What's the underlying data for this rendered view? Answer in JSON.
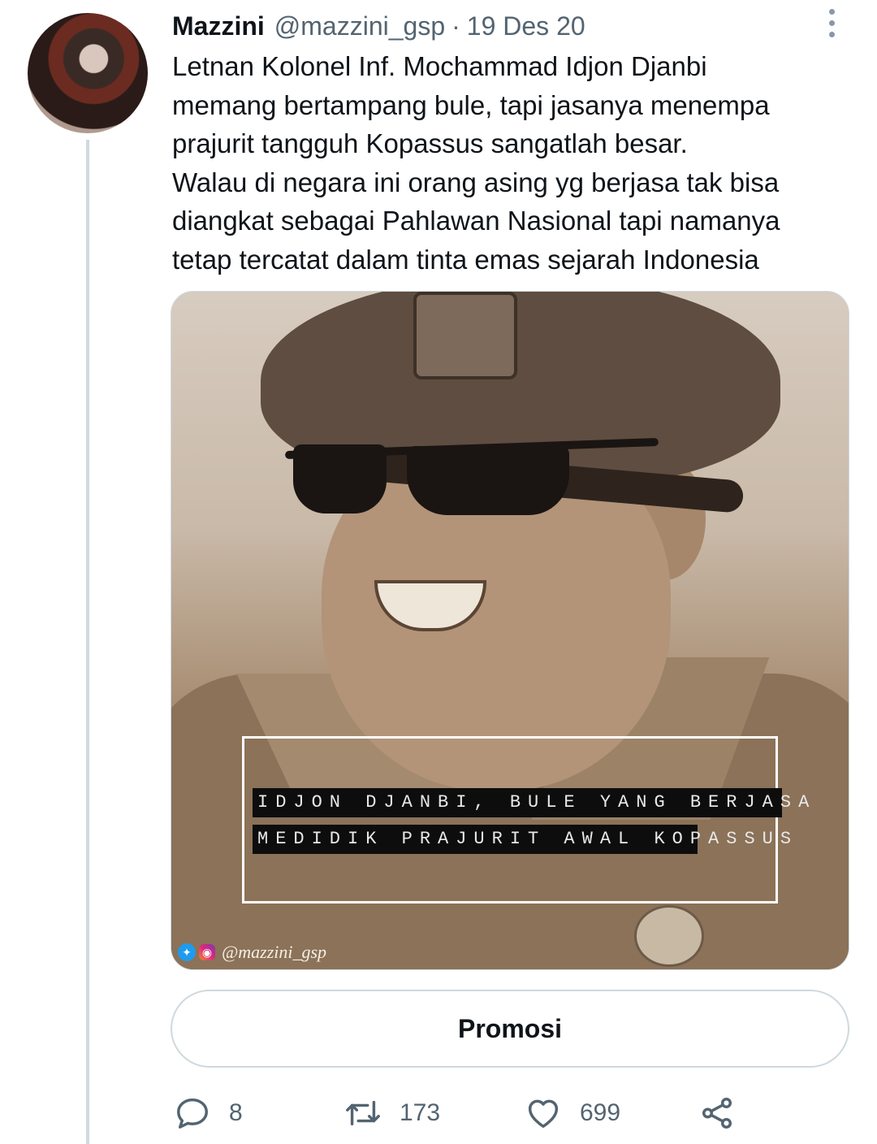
{
  "tweet": {
    "author": {
      "display_name": "Mazzini",
      "handle": "@mazzini_gsp",
      "separator": "·",
      "date": "19 Des 20"
    },
    "text_lines": [
      "Letnan Kolonel Inf. Mochammad Idjon Djanbi",
      "memang bertampang bule, tapi jasanya menempa",
      "prajurit tangguh Kopassus sangatlah besar.",
      "Walau di negara ini orang asing yg berjasa tak bisa",
      "diangkat sebagai Pahlawan Nasional tapi namanya",
      "tetap tercatat dalam tinta emas sejarah Indonesia"
    ],
    "media": {
      "caption_line1": "IDJON DJANBI, BULE YANG BERJASA",
      "caption_line2": "MEDIDIK PRAJURIT AWAL KOPASSUS",
      "watermark_handle": "@mazzini_gsp"
    },
    "promote_label": "Promosi",
    "actions": {
      "reply_count": "8",
      "retweet_count": "173",
      "like_count": "699"
    }
  },
  "icons": {
    "more": "more-vertical-icon",
    "reply": "reply-icon",
    "retweet": "retweet-icon",
    "like": "heart-icon",
    "share": "share-icon"
  },
  "colors": {
    "text_primary": "#0f1419",
    "text_secondary": "#536471",
    "border": "#cfd9de",
    "twitter_blue": "#1d9bf0"
  }
}
